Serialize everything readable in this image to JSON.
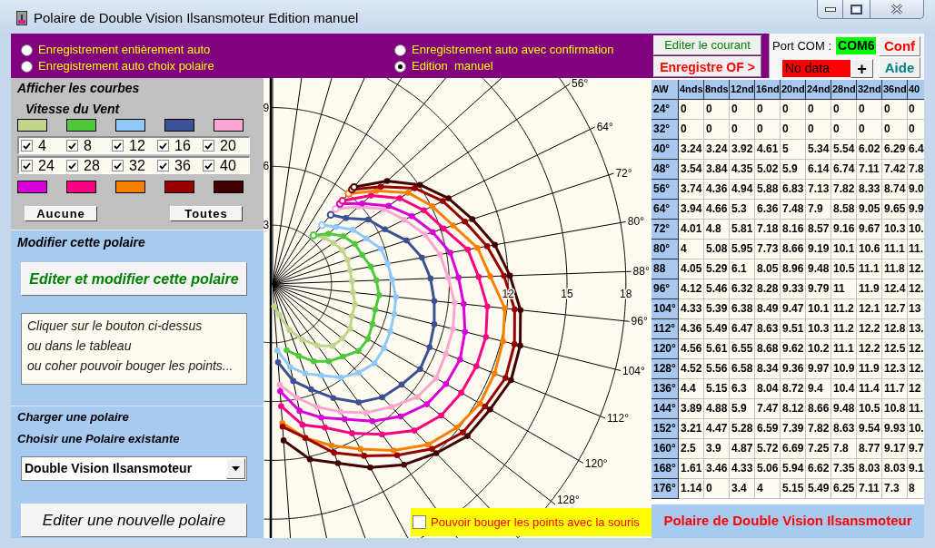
{
  "window": {
    "title": "Polaire de Double Vision Ilsansmoteur Edition manuel"
  },
  "save_modes": [
    {
      "label": "Enregistrement entièrement auto",
      "selected": false
    },
    {
      "label": "Enregistrement auto avec confirmation",
      "selected": false
    },
    {
      "label": "Enregistrement auto choix polaire",
      "selected": false
    },
    {
      "label": "Edition  manuel",
      "selected": true
    }
  ],
  "edit_current_button": "Editer le courant",
  "save_button": "Enregistre OF >",
  "com_port": {
    "label": "Port COM :",
    "port": "COM6",
    "status": "No data",
    "add_button": "+"
  },
  "conf_button": "Conf",
  "help_button": "Aide",
  "curves_panel": {
    "title": "Afficher les courbes",
    "subtitle": "Vitesse du Vent",
    "curves": [
      {
        "label": "4",
        "checked": true,
        "color": "#c0d48c"
      },
      {
        "label": "8",
        "checked": true,
        "color": "#50c83c"
      },
      {
        "label": "12",
        "checked": true,
        "color": "#90c8f8"
      },
      {
        "label": "16",
        "checked": true,
        "color": "#3c5094"
      },
      {
        "label": "20",
        "checked": true,
        "color": "#f8a8d0"
      },
      {
        "label": "24",
        "checked": true,
        "color": "#d800d8"
      },
      {
        "label": "28",
        "checked": true,
        "color": "#f80080"
      },
      {
        "label": "32",
        "checked": true,
        "color": "#f88000"
      },
      {
        "label": "36",
        "checked": true,
        "color": "#980000"
      },
      {
        "label": "40",
        "checked": true,
        "color": "#400000"
      }
    ],
    "none_button": "Aucune",
    "all_button": "Toutes"
  },
  "modify_panel": {
    "title": "Modifier cette polaire",
    "button": "Editer et modifier cette polaire",
    "help_lines": [
      "Cliquer sur le bouton ci-dessus",
      "ou dans le tableau",
      "ou coher pouvoir bouger les points..."
    ]
  },
  "load_panel": {
    "title": "Charger une polaire",
    "label": "Choisir une Polaire existante",
    "selected_polar": "Double Vision Ilsansmoteur",
    "new_button": "Editer une nouvelle polaire"
  },
  "chart": {
    "vertical_labels": [
      "9",
      "6",
      "3"
    ],
    "horizontal_labels": [
      "12",
      "15",
      "18"
    ],
    "angle_labels": [
      "56°",
      "64°",
      "72°",
      "80°",
      "88°",
      "96°",
      "104°",
      "112°",
      "120°",
      "128°"
    ]
  },
  "move_points": {
    "label": "Pouvoir bouger les points avec la souris",
    "checked": false
  },
  "table": {
    "columns": [
      "AW",
      "4nds",
      "8nds",
      "12nd",
      "16nd",
      "20nd",
      "24nd",
      "28nd",
      "32nd",
      "36nd",
      "40"
    ],
    "rows": [
      {
        "angle": "24°",
        "values": [
          "0",
          "0",
          "0",
          "0",
          "0",
          "0",
          "0",
          "0",
          "0",
          "0"
        ]
      },
      {
        "angle": "32°",
        "values": [
          "0",
          "0",
          "0",
          "0",
          "0",
          "0",
          "0",
          "0",
          "0",
          "0"
        ]
      },
      {
        "angle": "40°",
        "values": [
          "3.24",
          "3.24",
          "3.92",
          "4.61",
          "5",
          "5.34",
          "5.54",
          "6.02",
          "6.29",
          "6.4"
        ]
      },
      {
        "angle": "48°",
        "values": [
          "3.54",
          "3.84",
          "4.35",
          "5.02",
          "5.9",
          "6.14",
          "6.74",
          "7.11",
          "7.42",
          "7.8"
        ]
      },
      {
        "angle": "56°",
        "values": [
          "3.74",
          "4.36",
          "4.94",
          "5.88",
          "6.83",
          "7.13",
          "7.82",
          "8.33",
          "8.74",
          "9.0"
        ]
      },
      {
        "angle": "64°",
        "values": [
          "3.94",
          "4.66",
          "5.3",
          "6.36",
          "7.48",
          "7.9",
          "8.58",
          "9.05",
          "9.65",
          "9.9"
        ]
      },
      {
        "angle": "72°",
        "values": [
          "4.01",
          "4.8",
          "5.81",
          "7.18",
          "8.16",
          "8.57",
          "9.16",
          "9.67",
          "10.3",
          "10."
        ]
      },
      {
        "angle": "80°",
        "values": [
          "4",
          "5.08",
          "5.95",
          "7.73",
          "8.66",
          "9.19",
          "10.1",
          "10.6",
          "11.1",
          "11."
        ]
      },
      {
        "angle": "88",
        "values": [
          "4.05",
          "5.29",
          "6.1",
          "8.05",
          "8.96",
          "9.48",
          "10.5",
          "11.1",
          "11.8",
          "12."
        ]
      },
      {
        "angle": "96°",
        "values": [
          "4.12",
          "5.46",
          "6.32",
          "8.28",
          "9.33",
          "9.79",
          "11",
          "11.9",
          "12.4",
          "12."
        ]
      },
      {
        "angle": "104°",
        "values": [
          "4.33",
          "5.39",
          "6.38",
          "8.49",
          "9.47",
          "10.1",
          "11.2",
          "12.1",
          "12.7",
          "13"
        ]
      },
      {
        "angle": "112°",
        "values": [
          "4.36",
          "5.49",
          "6.47",
          "8.63",
          "9.51",
          "10.3",
          "11.2",
          "12.2",
          "12.8",
          "13."
        ]
      },
      {
        "angle": "120°",
        "values": [
          "4.56",
          "5.61",
          "6.55",
          "8.68",
          "9.62",
          "10.2",
          "11.1",
          "12.2",
          "12.5",
          "12."
        ]
      },
      {
        "angle": "128°",
        "values": [
          "4.52",
          "5.56",
          "6.58",
          "8.34",
          "9.36",
          "9.97",
          "10.9",
          "11.9",
          "12.3",
          "12."
        ]
      },
      {
        "angle": "136°",
        "values": [
          "4.4",
          "5.15",
          "6.3",
          "8.04",
          "8.72",
          "9.4",
          "10.4",
          "11.4",
          "11.7",
          "12"
        ]
      },
      {
        "angle": "144°",
        "values": [
          "3.89",
          "4.88",
          "5.9",
          "7.47",
          "8.12",
          "8.66",
          "9.48",
          "10.5",
          "10.8",
          "11."
        ]
      },
      {
        "angle": "152°",
        "values": [
          "3.21",
          "4.47",
          "5.28",
          "6.59",
          "7.39",
          "7.82",
          "8.63",
          "9.54",
          "9.93",
          "10."
        ]
      },
      {
        "angle": "160°",
        "values": [
          "2.5",
          "3.9",
          "4.87",
          "5.72",
          "6.69",
          "7.25",
          "7.8",
          "8.77",
          "9.17",
          "9.7"
        ]
      },
      {
        "angle": "168°",
        "values": [
          "1.61",
          "3.46",
          "4.33",
          "5.06",
          "5.94",
          "6.62",
          "7.35",
          "8.03",
          "8.03",
          "9.1"
        ]
      },
      {
        "angle": "176°",
        "values": [
          "1.14",
          "0",
          "3.4",
          "4",
          "5.15",
          "5.49",
          "6.25",
          "7.11",
          "7.3",
          "8"
        ]
      }
    ]
  },
  "status_bar": "Polaire de Double Vision Ilsansmoteur"
}
